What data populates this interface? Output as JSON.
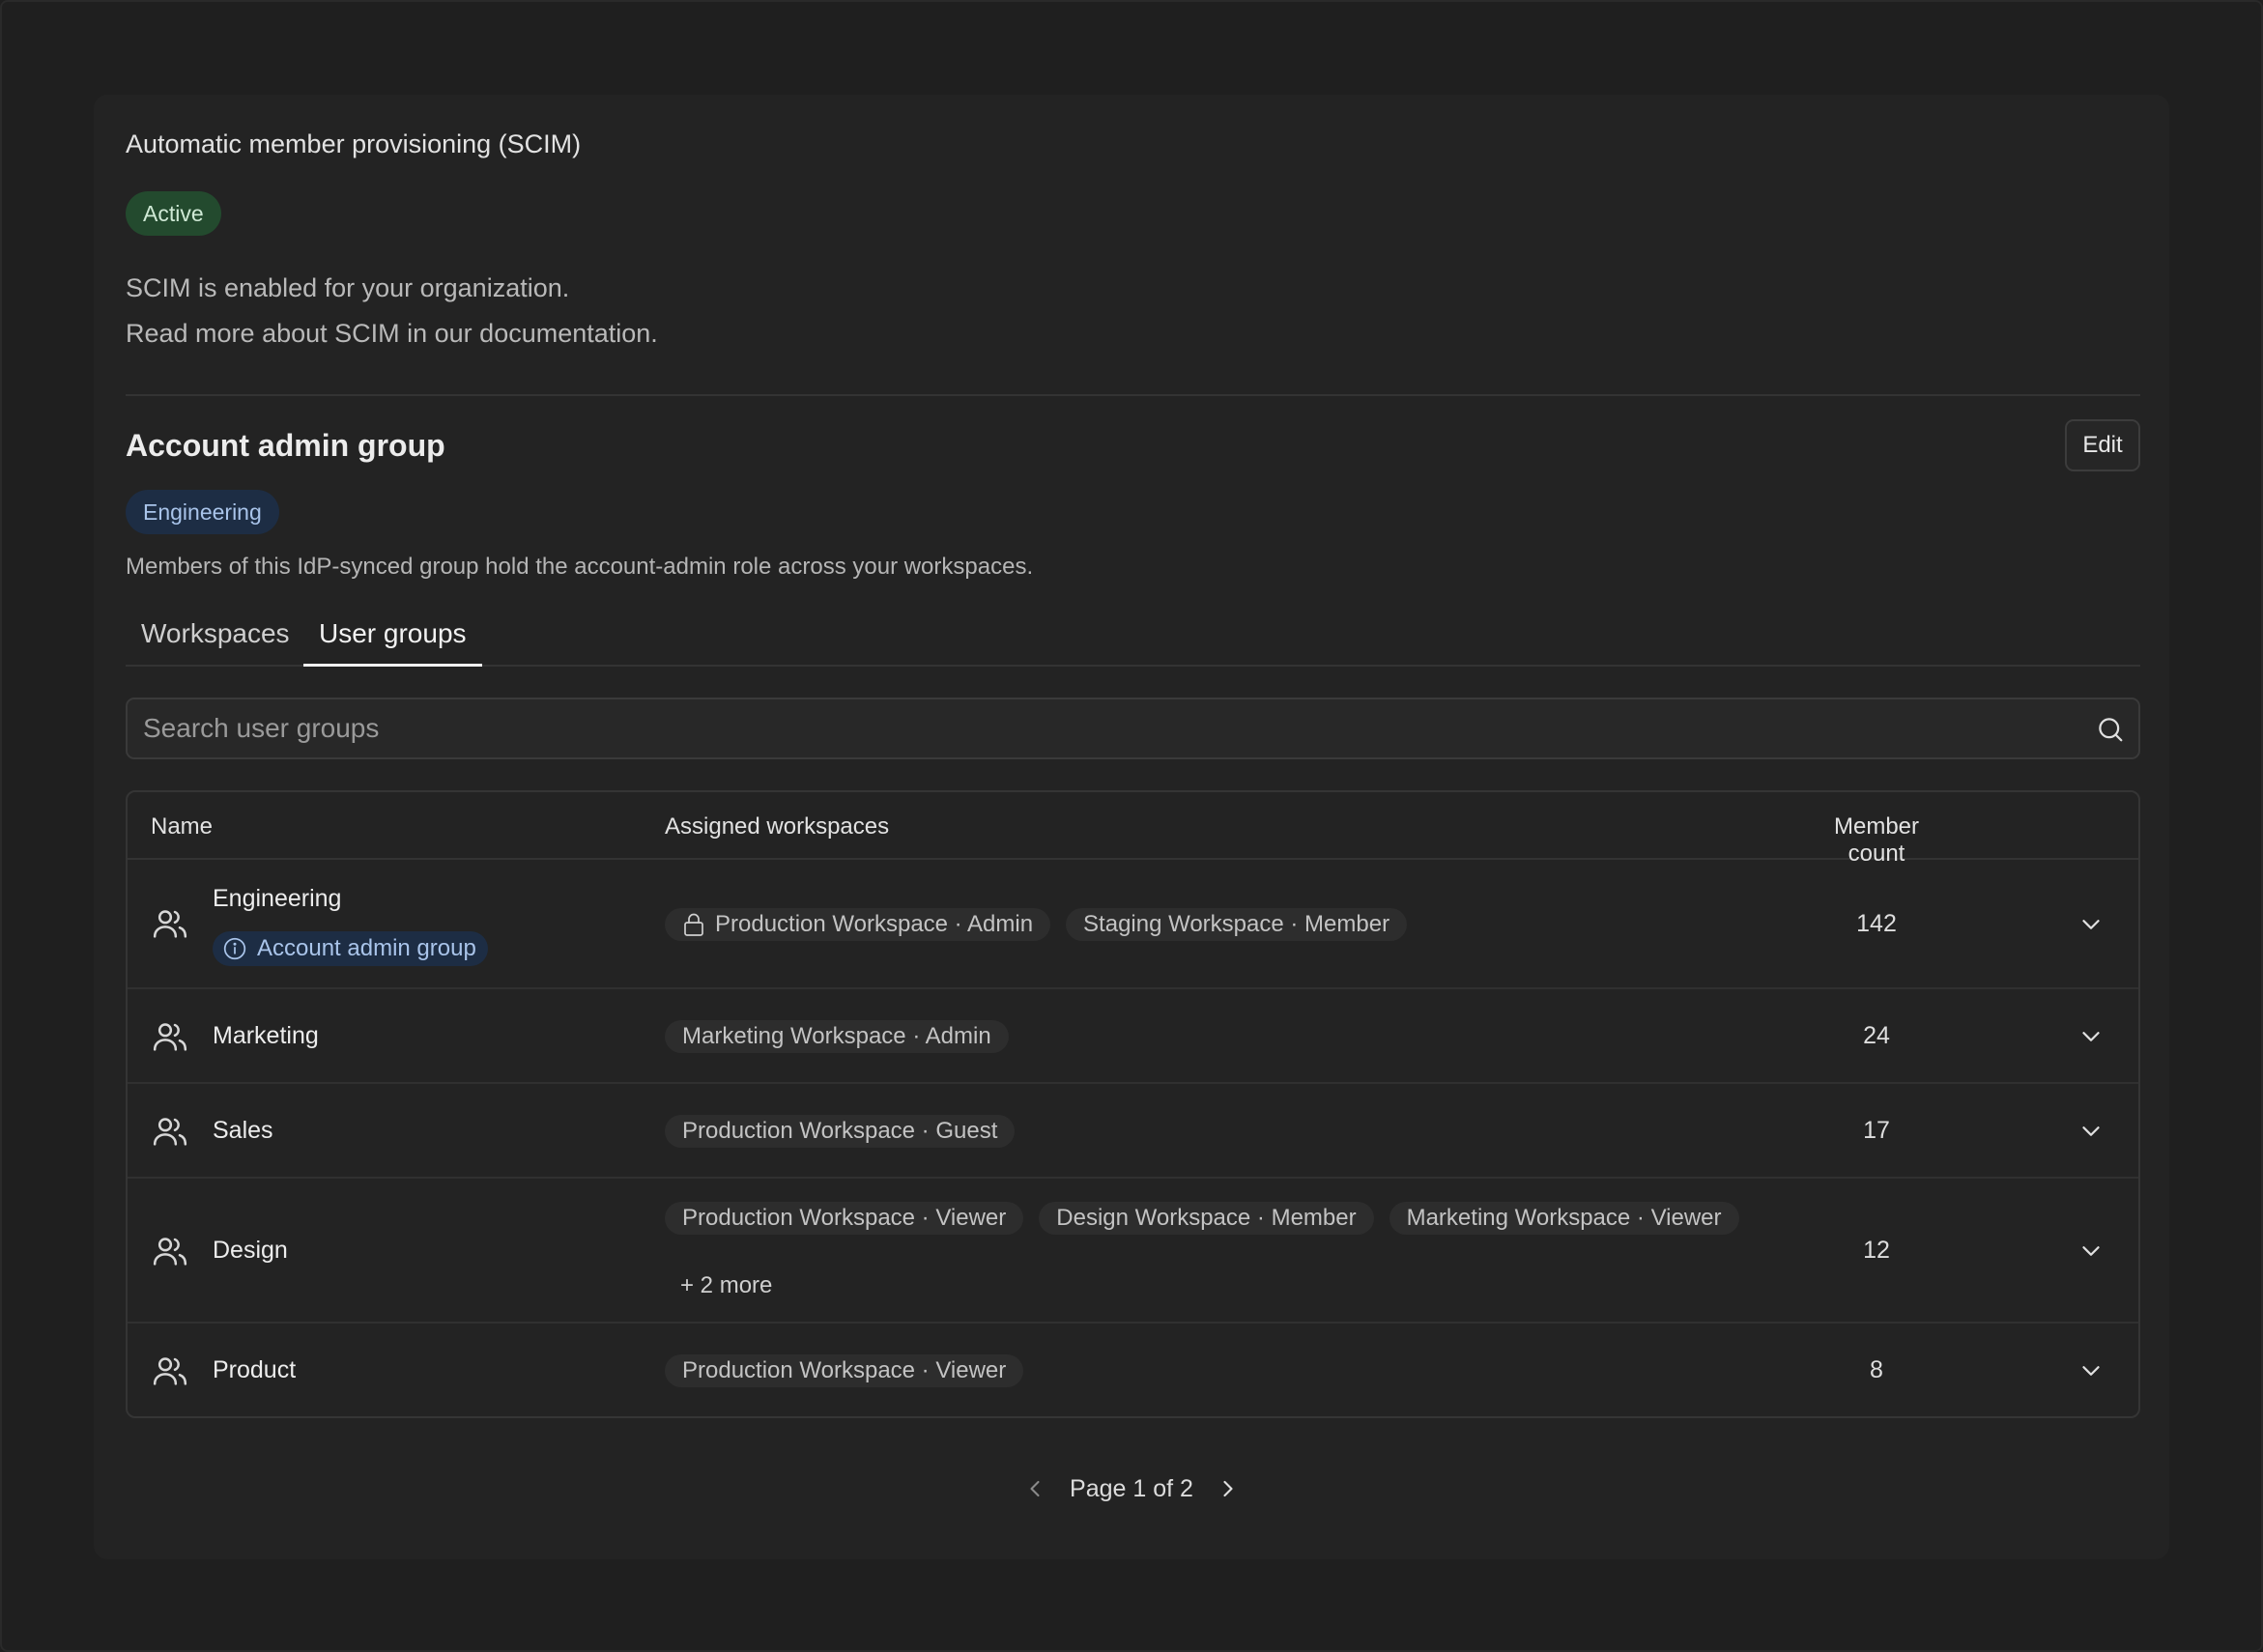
{
  "scim": {
    "title": "Automatic member provisioning (SCIM)",
    "status": "Active",
    "enabled_text": "SCIM is enabled for your organization.",
    "docs_text": "Read more about SCIM in our documentation."
  },
  "admin_group": {
    "title": "Account admin group",
    "edit_label": "Edit",
    "group_badge": "Engineering",
    "description": "Members of this IdP-synced group hold the account-admin role across your workspaces."
  },
  "tabs": [
    {
      "label": "Workspaces",
      "active": false
    },
    {
      "label": "User groups",
      "active": true
    }
  ],
  "search": {
    "placeholder": "Search user groups"
  },
  "table": {
    "columns": {
      "name": "Name",
      "workspaces": "Assigned workspaces",
      "members": "Member count"
    },
    "rows": [
      {
        "name": "Engineering",
        "admin_badge": "Account admin group",
        "workspaces": [
          "Production Workspace · Admin",
          "Staging Workspace · Member"
        ],
        "more": "",
        "member_count": "142"
      },
      {
        "name": "Marketing",
        "admin_badge": "",
        "workspaces": [
          "Marketing Workspace · Admin"
        ],
        "more": "",
        "member_count": "24"
      },
      {
        "name": "Sales",
        "admin_badge": "",
        "workspaces": [
          "Production Workspace · Guest"
        ],
        "more": "",
        "member_count": "17"
      },
      {
        "name": "Design",
        "admin_badge": "",
        "workspaces": [
          "Production Workspace · Viewer",
          "Design Workspace · Member",
          "Marketing Workspace · Viewer"
        ],
        "more": "+ 2 more",
        "member_count": "12"
      },
      {
        "name": "Product",
        "admin_badge": "",
        "workspaces": [
          "Production Workspace · Viewer"
        ],
        "more": "",
        "member_count": "8"
      }
    ]
  },
  "pagination": {
    "label": "Page 1 of 2"
  },
  "colors": {
    "accent_green": "#234a2e",
    "accent_blue": "#1d2d44",
    "background": "#1f1f1f"
  },
  "icons": [
    "users-icon",
    "lock-icon",
    "info-icon",
    "search-icon",
    "chevron-down-icon",
    "chevron-left-icon",
    "chevron-right-icon"
  ]
}
